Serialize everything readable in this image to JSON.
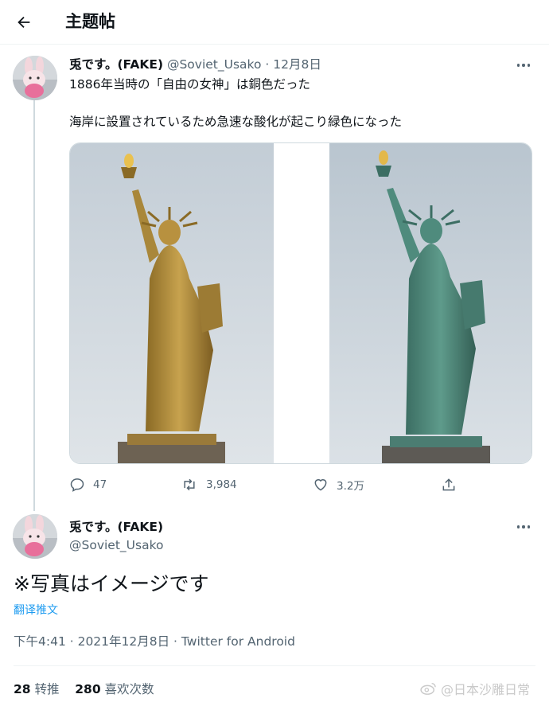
{
  "header": {
    "title": "主题帖",
    "back_icon": "back-arrow-icon"
  },
  "tweet": {
    "display_name": "兎です。(FAKE)",
    "handle": "@Soviet_Usako",
    "date": "12月8日",
    "text_line1": "1886年当時の「自由の女神」は銅色だった",
    "text_line2": "海岸に設置されているため急速な酸化が起こり緑色になった",
    "media_alt": [
      "statue-of-liberty-copper",
      "statue-of-liberty-green"
    ],
    "actions": {
      "replies": "47",
      "retweets": "3,984",
      "likes": "3.2万"
    }
  },
  "reply": {
    "display_name": "兎です。(FAKE)",
    "handle": "@Soviet_Usako",
    "text": "※写真はイメージです",
    "translate_label": "翻译推文",
    "meta": "下午4:41 · 2021年12月8日 · Twitter for Android",
    "stats": {
      "retweets_count": "28",
      "retweets_label": "转推",
      "likes_count": "280",
      "likes_label": "喜欢次数"
    }
  },
  "watermark": "@日本沙雕日常",
  "colors": {
    "accent": "#1d9bf0",
    "text": "#0f1419",
    "secondary": "#536471",
    "statue_copper": "#a9873a",
    "statue_green": "#4f8b7d"
  }
}
